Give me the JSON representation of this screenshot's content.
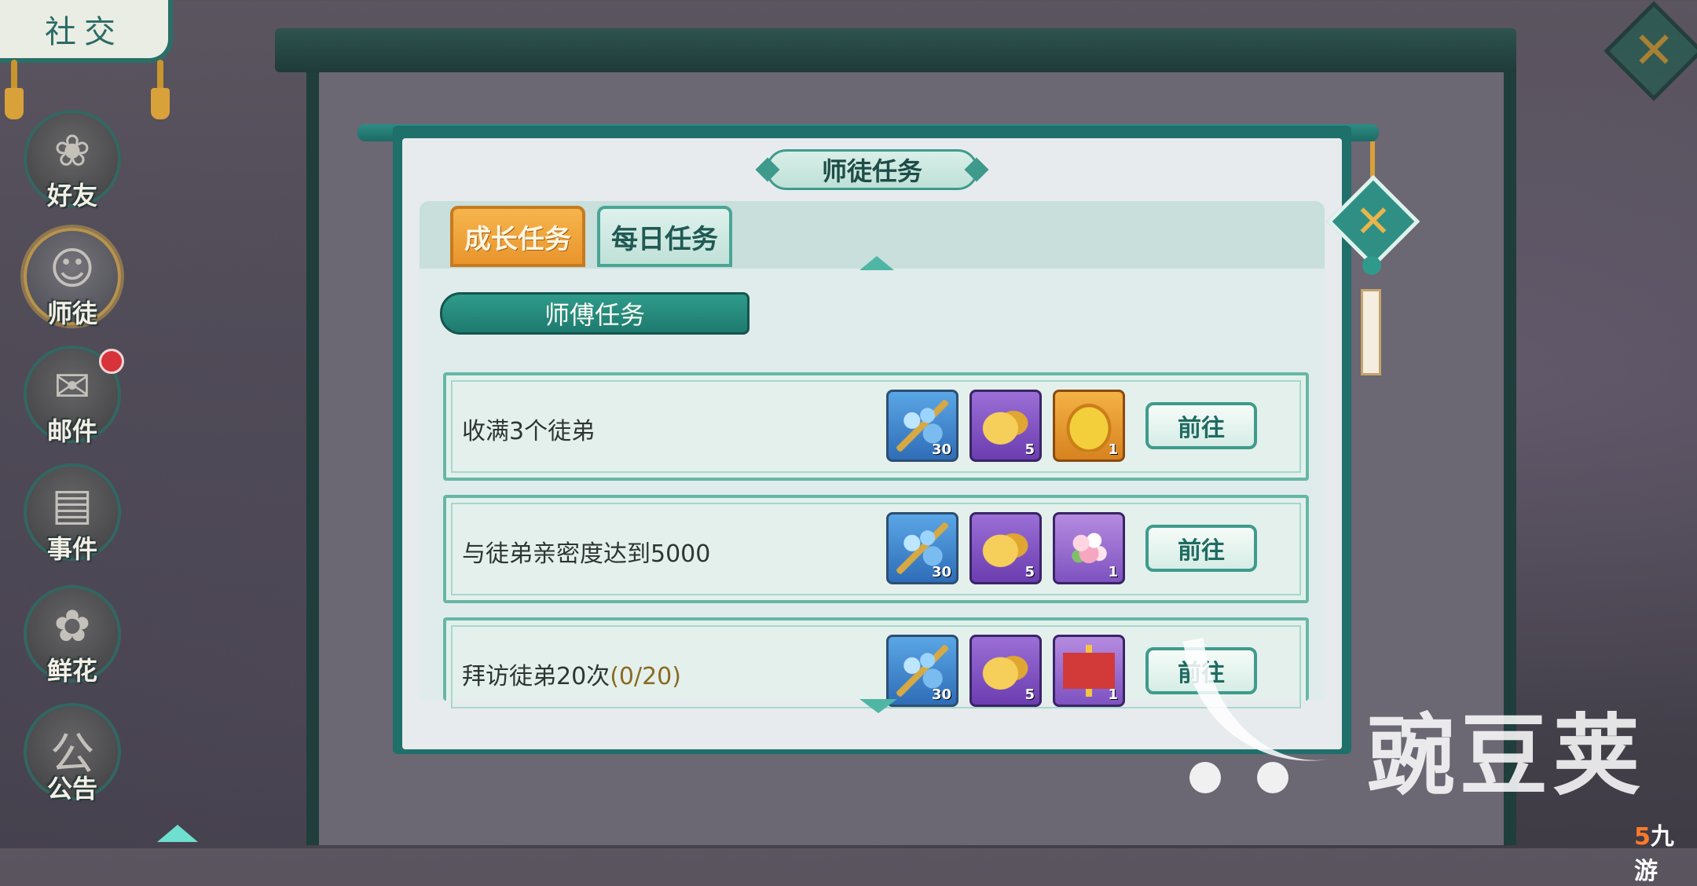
{
  "sidebar": {
    "title": "社交",
    "items": [
      {
        "label": "好友",
        "icon": "friends-icon",
        "glyph": "❀"
      },
      {
        "label": "师徒",
        "icon": "master-disciple-icon",
        "glyph": "☺",
        "active": true
      },
      {
        "label": "邮件",
        "icon": "mail-icon",
        "glyph": "✉",
        "badge": true
      },
      {
        "label": "事件",
        "icon": "event-book-icon",
        "glyph": "▤"
      },
      {
        "label": "鲜花",
        "icon": "flower-icon",
        "glyph": "✿"
      },
      {
        "label": "公告",
        "icon": "notice-icon",
        "glyph": "公"
      }
    ]
  },
  "dialog": {
    "title": "师徒任务",
    "tabs": [
      {
        "label": "成长任务",
        "active": true
      },
      {
        "label": "每日任务",
        "active": false
      }
    ],
    "section_title": "师傅任务",
    "close_symbol": "✕",
    "tasks": [
      {
        "text": "收满3个徒弟",
        "progress": "",
        "button": "前往",
        "rewards": [
          {
            "type": "blue",
            "name": "blue-beads-icon",
            "count": "30"
          },
          {
            "type": "purple",
            "name": "gold-ingot-chest-icon",
            "count": "5"
          },
          {
            "type": "orange",
            "name": "golden-pouch-icon",
            "count": "1"
          }
        ]
      },
      {
        "text": "与徒弟亲密度达到5000",
        "progress": "",
        "button": "前往",
        "rewards": [
          {
            "type": "blue",
            "name": "blue-beads-icon",
            "count": "30"
          },
          {
            "type": "purple",
            "name": "gold-ingot-chest-icon",
            "count": "5"
          },
          {
            "type": "flower",
            "name": "flower-bouquet-icon",
            "count": "1"
          }
        ]
      },
      {
        "text": "拜访徒弟20次",
        "progress": "(0/20)",
        "button": "前往",
        "rewards": [
          {
            "type": "blue",
            "name": "blue-beads-icon",
            "count": "30"
          },
          {
            "type": "purple",
            "name": "gold-ingot-chest-icon",
            "count": "5"
          },
          {
            "type": "gift",
            "name": "red-gift-box-icon",
            "count": "1"
          }
        ]
      }
    ]
  },
  "watermark": {
    "text": "豌豆荚",
    "corner_mark": "5",
    "corner_text": "九游"
  },
  "colors": {
    "frame": "#1f6f6a",
    "accent_orange": "#f6b54d",
    "accent_teal": "#3f9b8c",
    "progress_text": "#8a6a22"
  }
}
